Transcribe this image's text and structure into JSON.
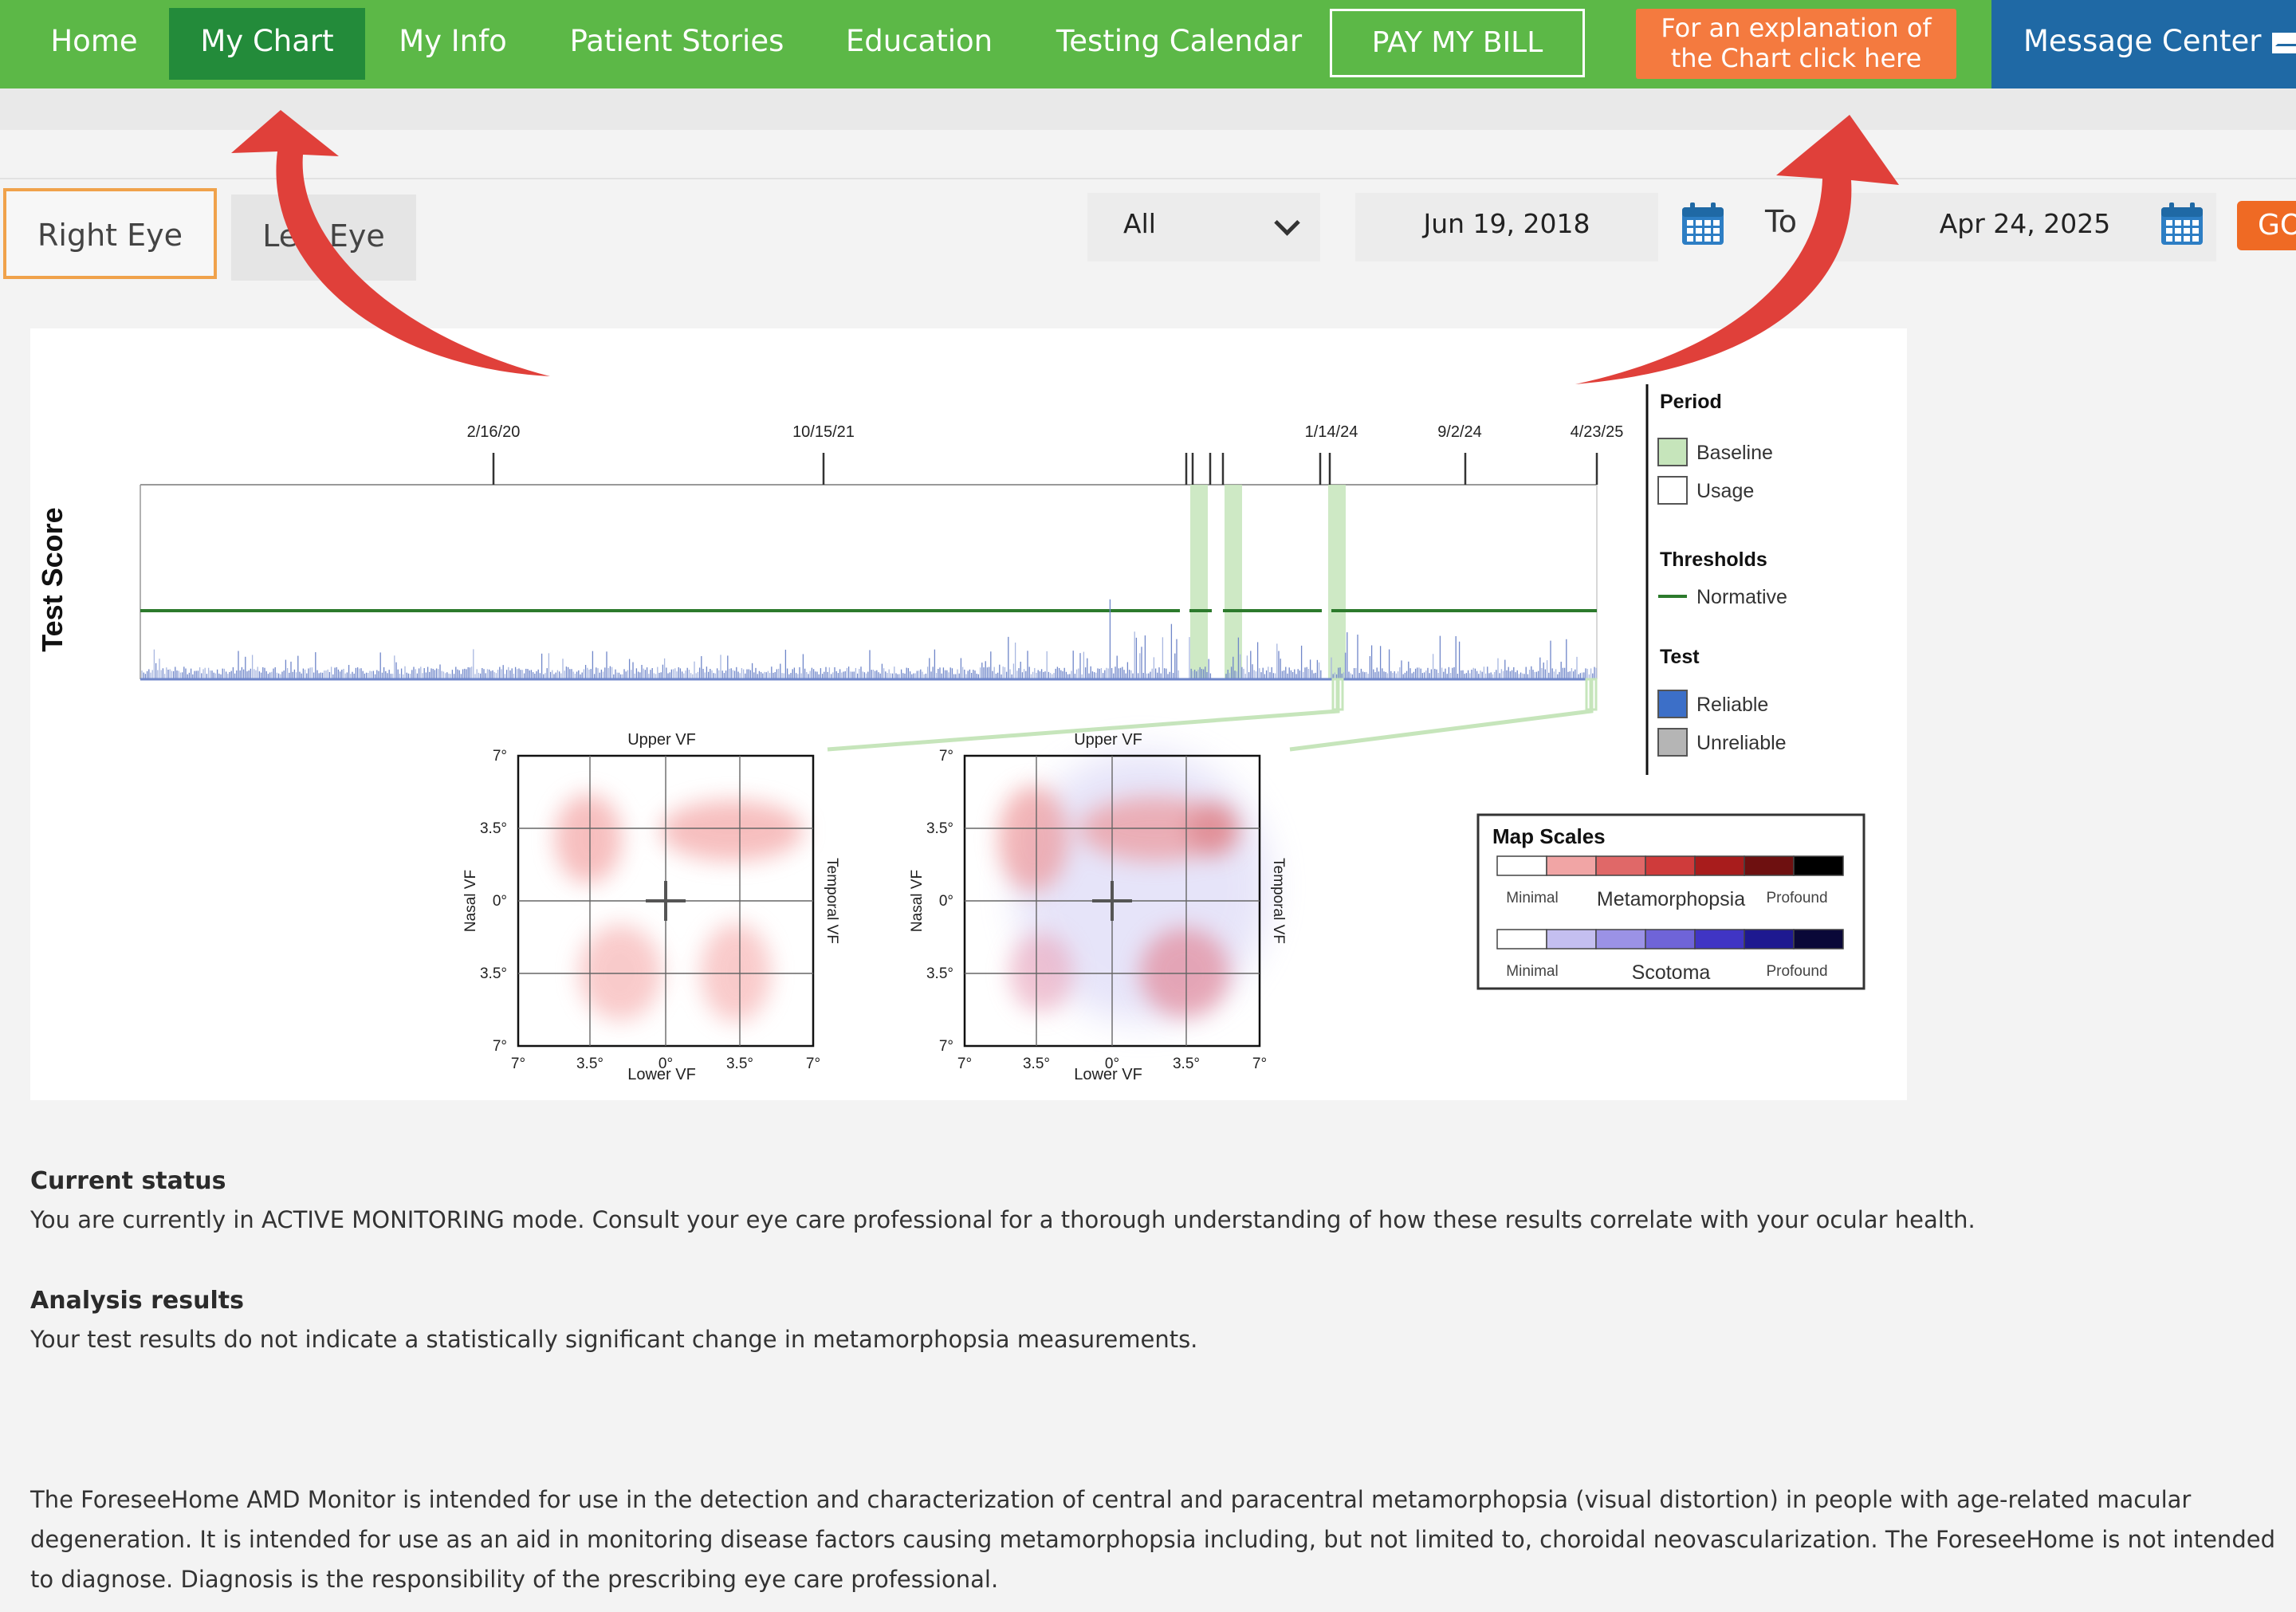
{
  "nav": {
    "home": "Home",
    "my_chart": "My Chart",
    "my_info": "My Info",
    "patient_stories": "Patient Stories",
    "education": "Education",
    "testing_calendar": "Testing Calendar",
    "pay_bill": "PAY MY BILL",
    "explain_line1": "For an explanation of",
    "explain_line2": "the Chart click here",
    "message_center": "Message Center"
  },
  "colors": {
    "nav_green": "#5cb847",
    "nav_active": "#238b3a",
    "explain_orange": "#f47a3f",
    "message_blue": "#1f69a5",
    "go_orange": "#ef6a24",
    "arrow_red": "#e0403a"
  },
  "controls": {
    "right_eye": "Right Eye",
    "left_eye": "Left Eye",
    "filter_value": "All",
    "from_date": "Jun 19, 2018",
    "to_label": "To",
    "to_date": "Apr 24, 2025",
    "go": "GO"
  },
  "chart_data": [
    {
      "type": "bar",
      "ylabel": "Test Score",
      "x_ticks": [
        "2/16/20",
        "10/15/21",
        "1/14/24",
        "9/2/24",
        "4/23/25"
      ],
      "normative_threshold": "Normative"
    },
    {
      "type": "heatmap",
      "top_label": "Upper VF",
      "bottom_label": "Lower VF",
      "left_label": "Nasal VF",
      "right_label": "Temporal VF",
      "y_ticks": [
        "7°",
        "3.5°",
        "0°",
        "3.5°",
        "7°"
      ],
      "x_ticks": [
        "7°",
        "3.5°",
        "0°",
        "3.5°",
        "7°"
      ]
    }
  ],
  "legend": {
    "period_title": "Period",
    "baseline": "Baseline",
    "usage": "Usage",
    "thresholds_title": "Thresholds",
    "normative": "Normative",
    "test_title": "Test",
    "reliable": "Reliable",
    "unreliable": "Unreliable"
  },
  "map_scales": {
    "title": "Map Scales",
    "minimal": "Minimal",
    "metamorphopsia": "Metamorphopsia",
    "profound": "Profound",
    "scotoma": "Scotoma",
    "meta_colors": [
      "#ffffff",
      "#f1a5a5",
      "#e06868",
      "#cf3b3b",
      "#a81c1c",
      "#6e1010",
      "#000000"
    ],
    "scot_colors": [
      "#ffffff",
      "#c4bff0",
      "#9b92e6",
      "#6f64d8",
      "#4035c4",
      "#1e1990",
      "#0a0838"
    ]
  },
  "status": {
    "current_title": "Current status",
    "current_text": "You are currently in ACTIVE MONITORING mode. Consult your eye care professional for a thorough understanding of how these results correlate with your ocular health.",
    "analysis_title": "Analysis results",
    "analysis_text": "Your test results do not indicate a statistically significant change in metamorphopsia measurements."
  },
  "disclaimer": "The ForeseeHome AMD Monitor is intended for use in the detection and characterization of central and paracentral metamorphopsia (visual distortion) in people with age-related macular degeneration. It is intended for use as an aid in monitoring disease factors causing metamorphopsia including, but not limited to, choroidal neovascularization. The ForeseeHome is not intended to diagnose. Diagnosis is the responsibility of the prescribing eye care professional."
}
